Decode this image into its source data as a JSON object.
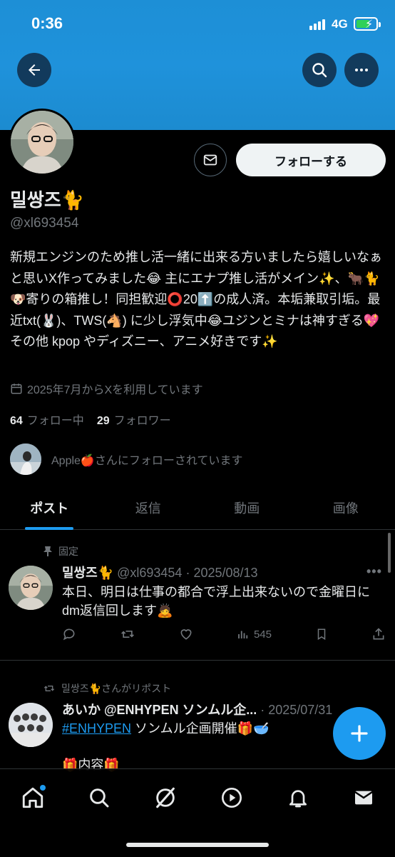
{
  "status": {
    "time": "0:36",
    "network": "4G"
  },
  "profile": {
    "follow_label": "フォローする",
    "display_name": "밀쌍즈🐈",
    "handle": "@xl693454",
    "bio": "新規エンジンのため推し活一緒に出来る方いましたら嬉しいなぁと思いX作ってみました😂 主にエナプ推し活がメイン✨、🐂🐈🐶寄りの箱推し！同担歓迎⭕20⬆️の成人済。本垢兼取引垢。最近txt(🐰)、TWS(🐴) に少し浮気中😂ユジンとミナは神すぎる💖その他 kpop やディズニー、アニメ好きです✨",
    "joined": "2025年7月からXを利用しています",
    "following_count": "64",
    "following_label": "フォロー中",
    "followers_count": "29",
    "followers_label": "フォロワー",
    "followed_by": "Apple🍎さんにフォローされています"
  },
  "tabs": [
    {
      "label": "ポスト",
      "active": true
    },
    {
      "label": "返信",
      "active": false
    },
    {
      "label": "動画",
      "active": false
    },
    {
      "label": "画像",
      "active": false
    }
  ],
  "posts": [
    {
      "context": "固定",
      "name": "밀쌍즈🐈",
      "meta": "@xl693454 · 2025/08/13",
      "text": "本日、明日は仕事の都合で浮上出来ないので金曜日にdm返信回します🙇",
      "views": "545"
    },
    {
      "context": "밀쌍즈🐈さんがリポスト",
      "name": "あいか @ENHYPEN ソンムル企...",
      "meta": "· 2025/07/31",
      "hashtag": "#ENHYPEN",
      "text": "ソンムル企画開催🎁🥣",
      "text2": "🎁内容🎁"
    }
  ],
  "colors": {
    "accent": "#1d9bf0",
    "banner": "#1f92db",
    "background": "#000000"
  }
}
